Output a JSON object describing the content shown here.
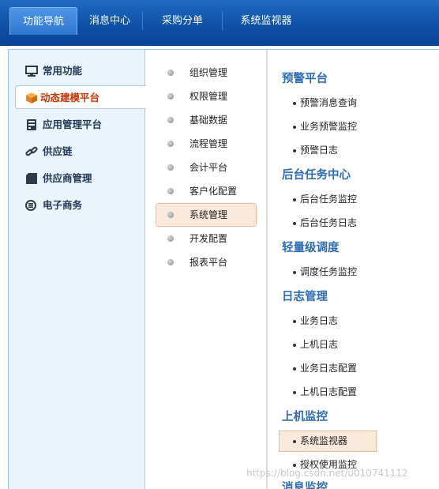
{
  "top_tabs": [
    {
      "label": "功能导航",
      "active": true
    },
    {
      "label": "消息中心"
    },
    {
      "label": "采购分单"
    },
    {
      "label": "系统监视器"
    }
  ],
  "left_nav": [
    {
      "label": "常用功能",
      "icon": "monitor-icon"
    },
    {
      "label": "动态建模平台",
      "icon": "cube-icon",
      "active": true
    },
    {
      "label": "应用管理平台",
      "icon": "server-icon"
    },
    {
      "label": "供应链",
      "icon": "link-icon"
    },
    {
      "label": "供应商管理",
      "icon": "folder-icon"
    },
    {
      "label": "电子商务",
      "icon": "circle-e-icon"
    }
  ],
  "sub_nav": [
    {
      "label": "组织管理"
    },
    {
      "label": "权限管理"
    },
    {
      "label": "基础数据"
    },
    {
      "label": "流程管理"
    },
    {
      "label": "会计平台"
    },
    {
      "label": "客户化配置"
    },
    {
      "label": "系统管理",
      "active": true
    },
    {
      "label": "开发配置"
    },
    {
      "label": "报表平台"
    }
  ],
  "groups": [
    {
      "title": "预警平台",
      "items": [
        "预警消息查询",
        "业务预警监控",
        "预警日志"
      ]
    },
    {
      "title": "后台任务中心",
      "items": [
        "后台任务监控",
        "后台任务日志"
      ]
    },
    {
      "title": "轻量级调度",
      "items": [
        "调度任务监控"
      ]
    },
    {
      "title": "日志管理",
      "items": [
        "业务日志",
        "上机日志",
        "业务日志配置",
        "上机日志配置"
      ]
    },
    {
      "title": "上机监控",
      "items": [
        "系统监视器",
        "授权使用监控"
      ]
    },
    {
      "title": "消息监控",
      "items": []
    }
  ],
  "active_leaf": "系统监视器",
  "watermark": "https://blog.csdn.net/u010741112",
  "colors": {
    "topbar": "#0d4fa5",
    "active_text": "#cc3300",
    "group_title": "#2b6cb5",
    "highlight_bg": "#fbe9dc",
    "highlight_border": "#f1bc95",
    "nav_bg": "#eaf4fd"
  }
}
